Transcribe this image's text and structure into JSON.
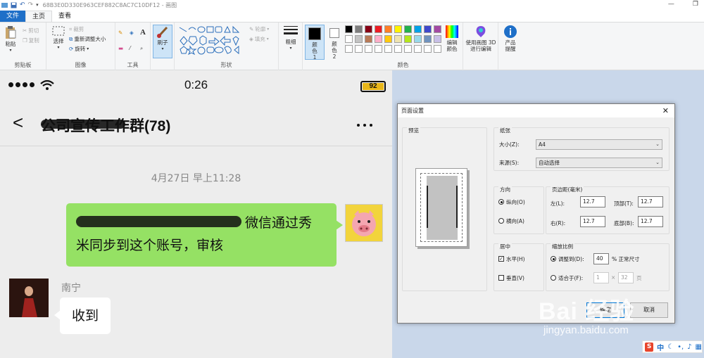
{
  "window": {
    "title": "68B3E0D330E963CEF882C8AC7C10DF12 - 画图"
  },
  "tabs": {
    "file": "文件",
    "home": "主页",
    "view": "查看"
  },
  "ribbon": {
    "clipboard": {
      "label": "剪贴板",
      "paste": "粘贴",
      "cut": "剪切",
      "copy": "复制"
    },
    "image": {
      "label": "图像",
      "select": "选择",
      "crop": "裁剪",
      "resize": "重新调整大小",
      "rotate": "旋转"
    },
    "tools": {
      "label": "工具"
    },
    "brushes": {
      "label": "刷子"
    },
    "shapes": {
      "label": "形状",
      "outline": "轮廓",
      "fill": "填充"
    },
    "size": {
      "label": "粗细"
    },
    "color1": {
      "label": "颜色 1"
    },
    "color2": {
      "label": "颜色 2"
    },
    "colors": {
      "label": "颜色",
      "edit": "编辑颜色"
    },
    "paint3d": {
      "label": "使用画图 3D 进行编辑"
    },
    "product": {
      "label": "产品提醒"
    },
    "palette": [
      "#000000",
      "#7f7f7f",
      "#880015",
      "#ed1c24",
      "#ff7f27",
      "#fff200",
      "#22b14c",
      "#00a2e8",
      "#3f48cc",
      "#a349a4",
      "#ffffff",
      "#c3c3c3",
      "#b97a57",
      "#ffaec9",
      "#ffc90e",
      "#efe4b0",
      "#b5e61d",
      "#99d9ea",
      "#7092be",
      "#c8bfe7"
    ]
  },
  "phone": {
    "time": "0:26",
    "battery": "92",
    "chat_title": "公司宣传工作群(78)",
    "timestamp": "4月27日 早上11:28",
    "sent_line1": "微信通过秀",
    "sent_line2": "米同步到这个账号，审核",
    "sender": "南宁",
    "received": "收到"
  },
  "dialog": {
    "title": "页面设置",
    "preview": "预览",
    "paper": "纸张",
    "size_label": "大小(Z):",
    "size_value": "A4",
    "source_label": "来源(S):",
    "source_value": "自动选择",
    "orientation": "方向",
    "portrait": "纵向(O)",
    "landscape": "横向(A)",
    "margins": "页边距(毫米)",
    "left_label": "左(L):",
    "left_value": "12.7",
    "right_label": "右(R):",
    "right_value": "12.7",
    "top_label": "顶部(T):",
    "top_value": "12.7",
    "bottom_label": "底部(B):",
    "bottom_value": "12.7",
    "center": "居中",
    "horizontal": "水平(H)",
    "vertical": "垂直(V)",
    "scaling": "缩放比例",
    "adjust_label": "调整到(D):",
    "adjust_value": "40",
    "adjust_unit": "% 正常尺寸",
    "fit_label": "适合于(F):",
    "fit_w": "1",
    "fit_h": "32",
    "fit_unit": "页",
    "ok": "确定",
    "cancel": "取消"
  },
  "watermark": {
    "logo": "Bai 经验",
    "url": "jingyan.baidu.com"
  },
  "ime": {
    "lang": "中"
  }
}
